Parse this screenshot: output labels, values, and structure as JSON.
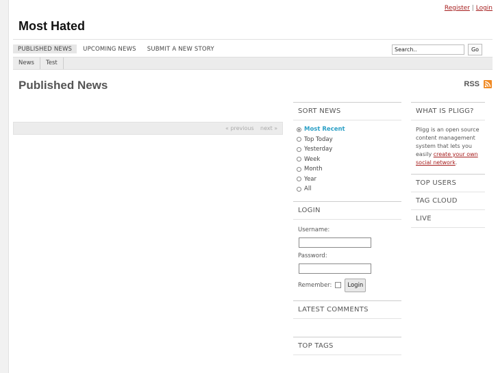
{
  "header": {
    "register_label": "Register",
    "separator": "|",
    "login_label": "Login",
    "site_title": "Most Hated"
  },
  "nav": {
    "items": [
      "PUBLISHED NEWS",
      "UPCOMING NEWS",
      "SUBMIT A NEW STORY"
    ]
  },
  "search": {
    "value": "Search..",
    "go_label": "Go"
  },
  "subnav": {
    "items": [
      "News",
      "Test"
    ]
  },
  "main": {
    "title": "Published News",
    "rss_label": "RSS",
    "pager": {
      "prev_label": "« previous",
      "next_label": "next »"
    }
  },
  "sidebar_mid": {
    "sort_title": "SORT NEWS",
    "sort_options": [
      "Most Recent",
      "Top Today",
      "Yesterday",
      "Week",
      "Month",
      "Year",
      "All"
    ],
    "login_title": "LOGIN",
    "username_label": "Username:",
    "password_label": "Password:",
    "remember_label": "Remember:",
    "login_button": "Login",
    "latest_comments_title": "LATEST COMMENTS",
    "top_tags_title": "TOP TAGS"
  },
  "sidebar_right": {
    "about_title": "WHAT IS PLIGG?",
    "about_text": "Pligg is an open source content management system that lets you easily",
    "about_link": "create your own social network",
    "about_end": ".",
    "top_users_title": "TOP USERS",
    "tag_cloud_title": "TAG CLOUD",
    "live_title": "LIVE"
  },
  "colors": {
    "accent_link": "#a51b1b",
    "selected_sort": "#2ca0c6",
    "rss_orange": "#f08a24"
  }
}
